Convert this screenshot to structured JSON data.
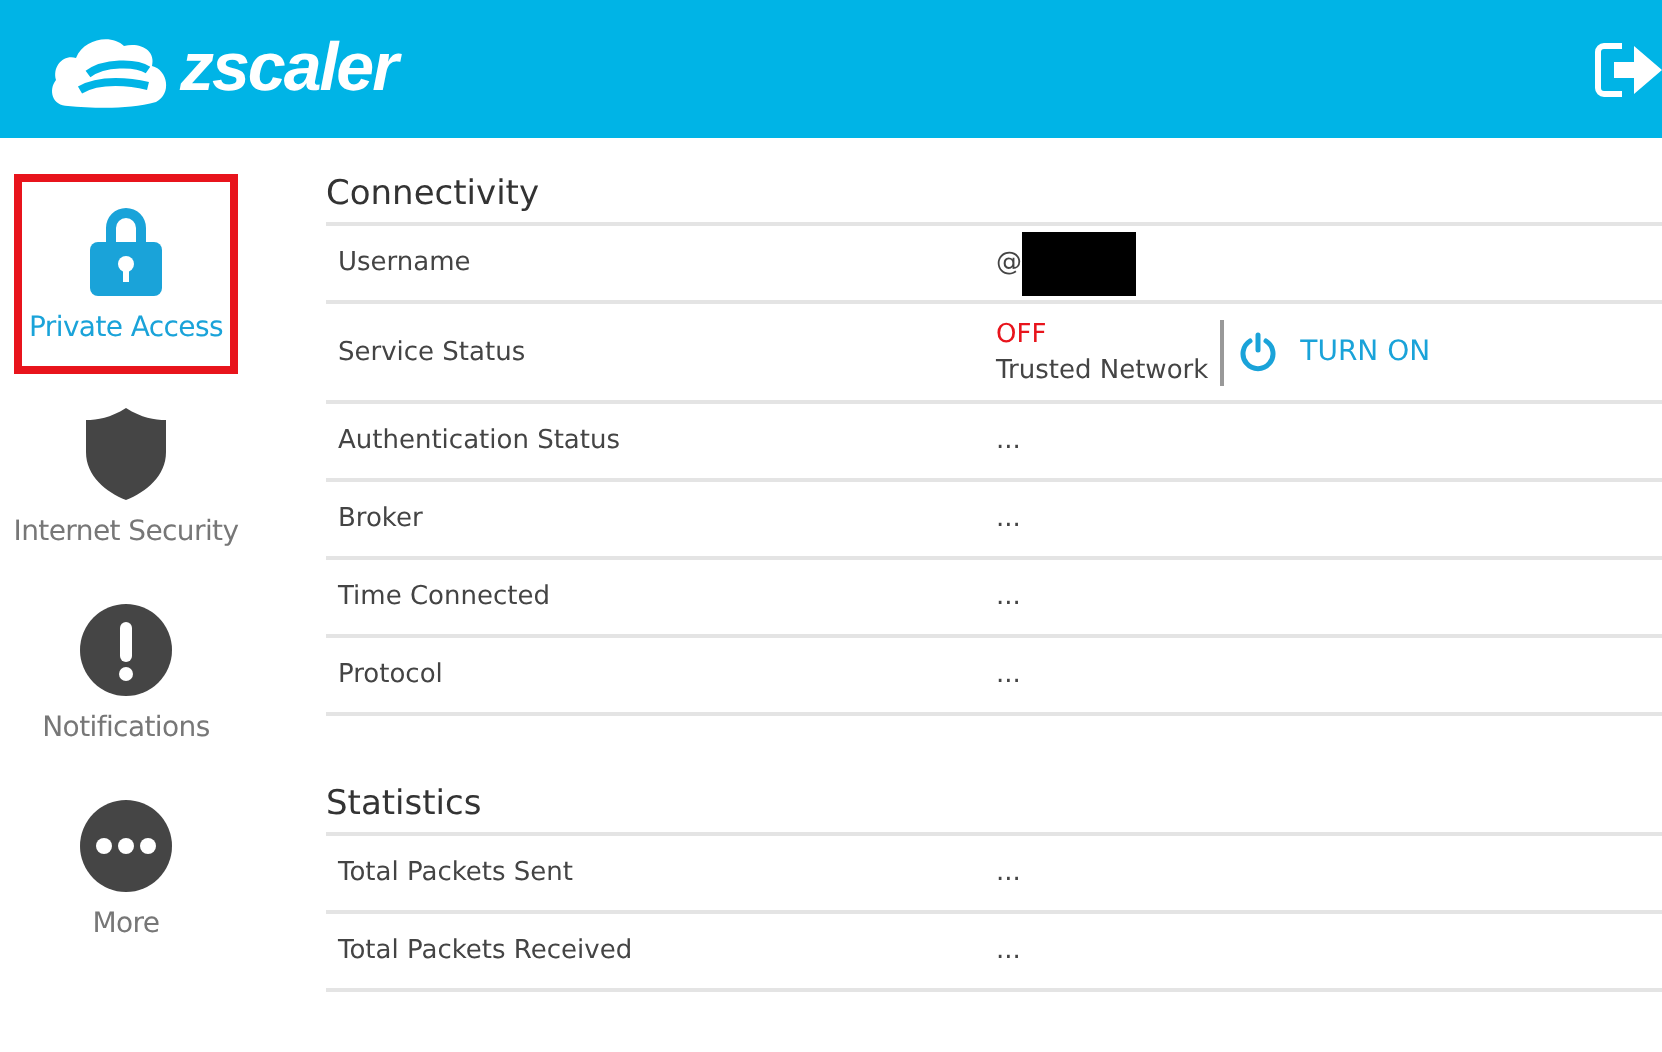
{
  "header": {
    "logo_text": "zscaler"
  },
  "sidebar": {
    "items": [
      {
        "label": "Private Access",
        "kind": "lock",
        "selected": true
      },
      {
        "label": "Internet Security",
        "kind": "shield",
        "selected": false
      },
      {
        "label": "Notifications",
        "kind": "alert",
        "selected": false
      },
      {
        "label": "More",
        "kind": "more",
        "selected": false
      }
    ]
  },
  "sections": [
    {
      "title": "Connectivity",
      "rows": [
        {
          "label": "Username",
          "kind": "redacted",
          "value": "@"
        },
        {
          "label": "Service Status",
          "kind": "status",
          "status": "OFF",
          "network": "Trusted Network",
          "action": "TURN ON"
        },
        {
          "label": "Authentication Status",
          "kind": "text",
          "value": "..."
        },
        {
          "label": "Broker",
          "kind": "text",
          "value": "..."
        },
        {
          "label": "Time Connected",
          "kind": "text",
          "value": "..."
        },
        {
          "label": "Protocol",
          "kind": "text",
          "value": "..."
        }
      ]
    },
    {
      "title": "Statistics",
      "rows": [
        {
          "label": "Total Packets Sent",
          "kind": "text",
          "value": "..."
        },
        {
          "label": "Total Packets Received",
          "kind": "text",
          "value": "..."
        }
      ]
    }
  ]
}
